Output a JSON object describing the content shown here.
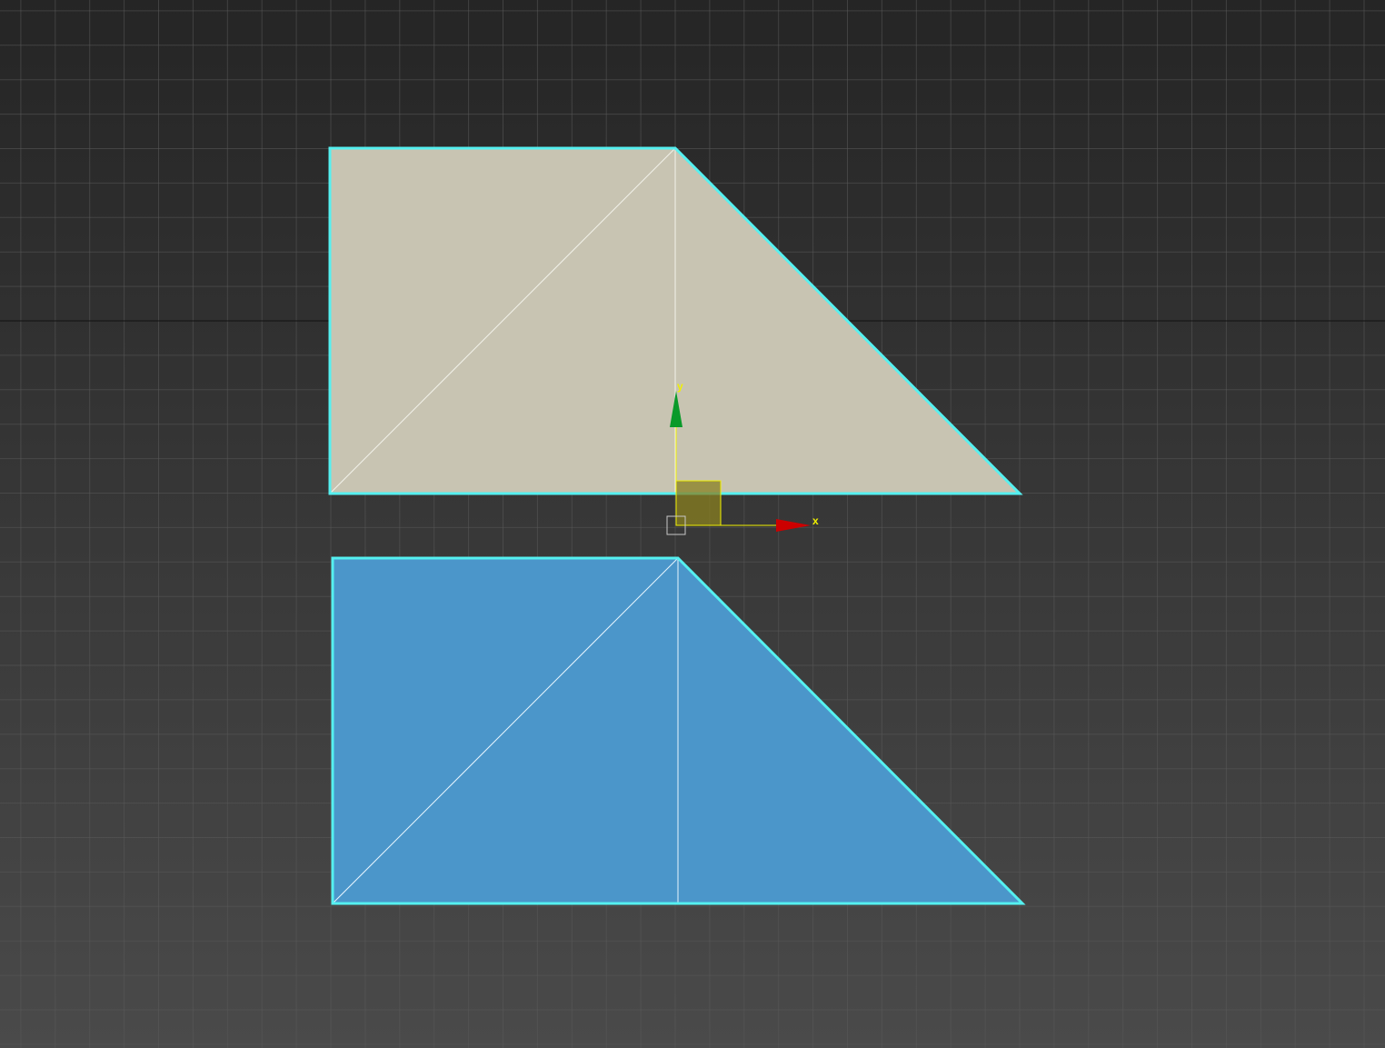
{
  "viewport": {
    "background_top": "#252525",
    "background_bottom": "#4a4a4a",
    "grid_color": "#5a5a5a",
    "home_grid_color": "#111111"
  },
  "objects": [
    {
      "name": "top-trapezoid",
      "fill": "#c8c4b2",
      "edge": "#55f0f0",
      "wire": "#f2f2ea",
      "selected": true
    },
    {
      "name": "bottom-trapezoid",
      "fill": "#4b96ca",
      "edge": "#55f0f0",
      "wire": "#e8f6ff",
      "selected": true
    }
  ],
  "gizmo": {
    "x_label": "x",
    "y_label": "y",
    "x_color": "#cc0000",
    "y_color": "#0a9a2a",
    "active_color": "#f0f000",
    "plane_color": "#8a8020"
  }
}
